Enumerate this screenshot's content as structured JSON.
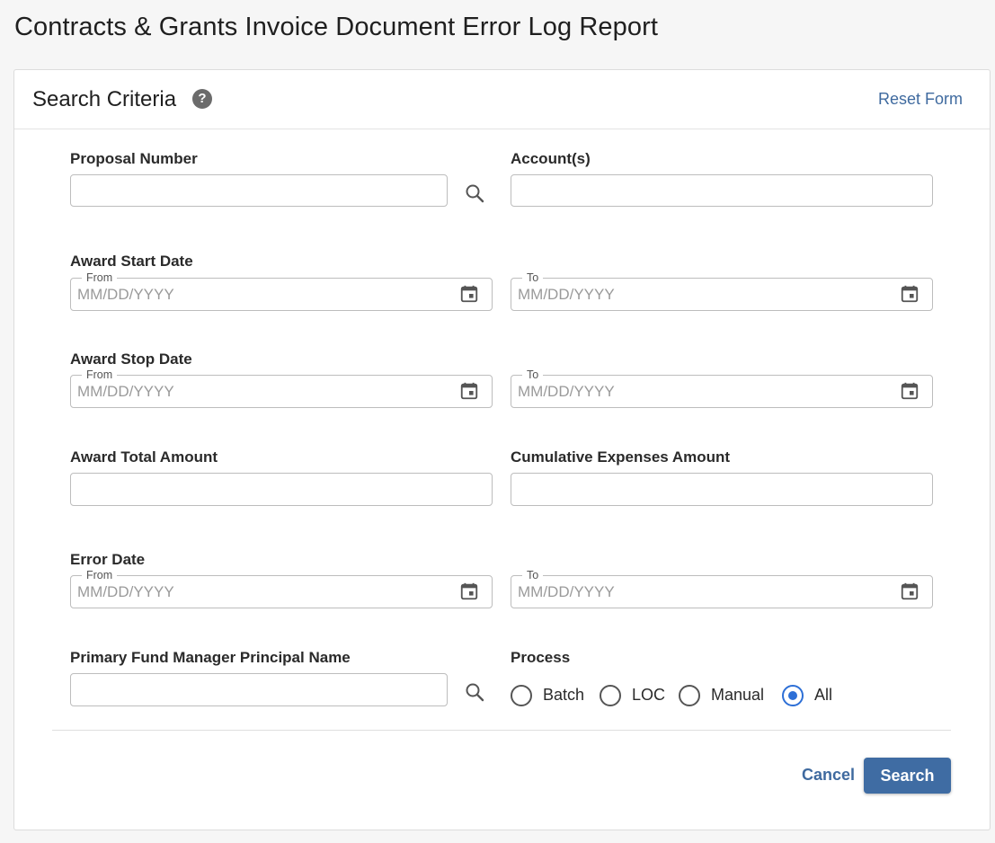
{
  "page": {
    "title": "Contracts & Grants Invoice Document Error Log Report"
  },
  "search_criteria": {
    "title": "Search Criteria",
    "help_icon": "question-circle-icon",
    "help_glyph": "?",
    "reset_label": "Reset Form"
  },
  "fields": {
    "proposal_number": {
      "label": "Proposal Number",
      "value": ""
    },
    "accounts": {
      "label": "Account(s)",
      "value": ""
    },
    "award_start_date": {
      "label": "Award Start Date",
      "from_legend": "From",
      "to_legend": "To",
      "placeholder": "MM/DD/YYYY"
    },
    "award_stop_date": {
      "label": "Award Stop Date",
      "from_legend": "From",
      "to_legend": "To",
      "placeholder": "MM/DD/YYYY"
    },
    "award_total_amount": {
      "label": "Award Total Amount",
      "value": ""
    },
    "cumulative_expenses_amount": {
      "label": "Cumulative Expenses Amount",
      "value": ""
    },
    "error_date": {
      "label": "Error Date",
      "from_legend": "From",
      "to_legend": "To",
      "placeholder": "MM/DD/YYYY"
    },
    "primary_fund_manager": {
      "label": "Primary Fund Manager Principal Name",
      "value": ""
    },
    "process": {
      "label": "Process",
      "options": [
        "Batch",
        "LOC",
        "Manual",
        "All"
      ],
      "selected": "All"
    }
  },
  "actions": {
    "cancel_label": "Cancel",
    "search_label": "Search"
  },
  "colors": {
    "accent": "#3f6ca3",
    "link": "#3f6a9f",
    "radio_selected": "#2d6fd6"
  }
}
